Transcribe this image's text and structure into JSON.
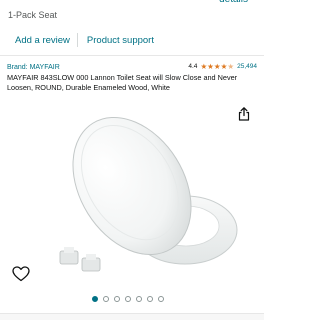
{
  "header": {
    "details_link": "details",
    "pack_label": "1-Pack Seat"
  },
  "actions": {
    "add_review": "Add a review",
    "product_support": "Product support"
  },
  "product": {
    "brand": "Brand: MAYFAIR",
    "rating": "4.4",
    "stars": 4.4,
    "review_count": "25,494",
    "title": "MAYFAIR 843SLOW 000 Lannon Toilet Seat will Slow Close and Never Loosen, ROUND, Durable Enameled Wood, White"
  },
  "gallery": {
    "image_count": 7,
    "active_index": 0
  },
  "icons": {
    "share": "share-icon",
    "wishlist": "heart-icon"
  },
  "colors": {
    "link": "#007185",
    "star": "#de7921",
    "text": "#0f1111"
  }
}
